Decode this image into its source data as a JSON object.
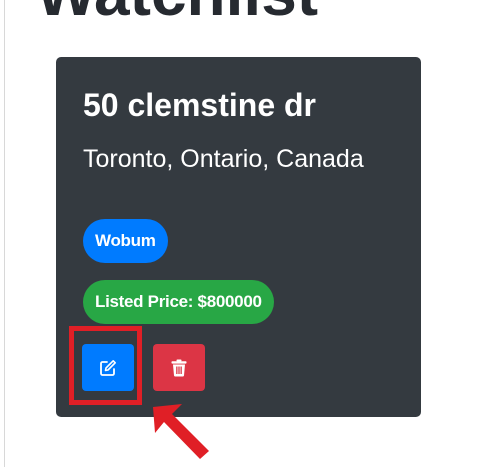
{
  "page": {
    "heading": "Watchlist"
  },
  "card": {
    "title": "50 clemstine dr",
    "subtitle": "Toronto, Ontario, Canada",
    "area_badge": "Wobum",
    "price_badge": "Listed Price: $800000"
  },
  "actions": {
    "edit_icon": "edit-icon",
    "delete_icon": "trash-icon"
  },
  "annotation": {
    "highlight_color": "#e01f26",
    "arrow_icon": "arrow-up-left-icon"
  },
  "colors": {
    "card_bg": "#343a40",
    "primary": "#007bff",
    "success": "#28a745",
    "danger": "#dc3545"
  }
}
